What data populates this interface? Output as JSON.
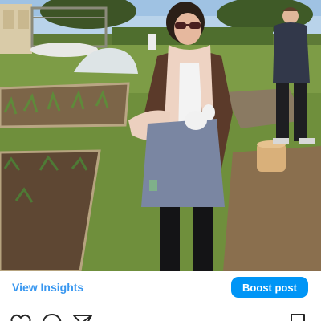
{
  "post": {
    "photo_icon": "garden-photo"
  },
  "insights": {
    "view_label": "View Insights",
    "boost_label": "Boost post"
  },
  "actions": {
    "like_icon": "heart-icon",
    "comment_icon": "comment-icon",
    "share_icon": "send-icon",
    "save_icon": "bookmark-icon"
  },
  "colors": {
    "link_blue": "#3897f0",
    "button_blue": "#0095f6",
    "text_dark": "#262626"
  }
}
